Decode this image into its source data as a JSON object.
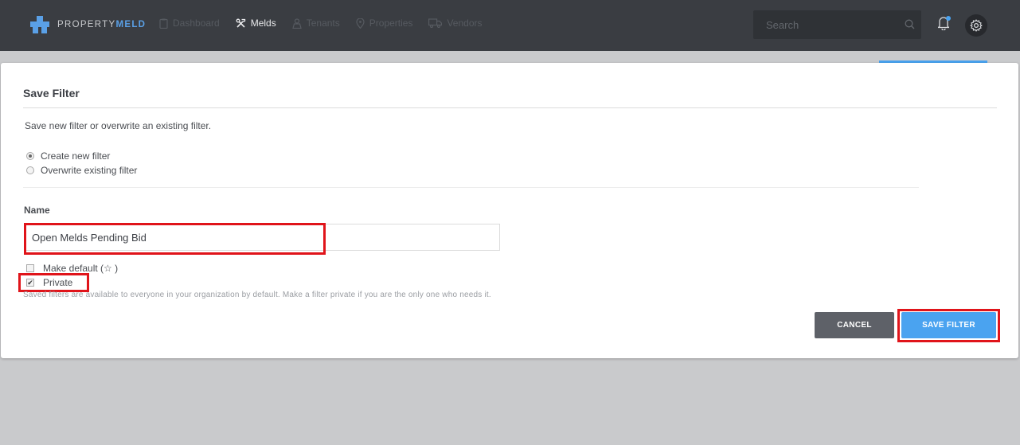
{
  "app": {
    "logo": {
      "prefix": "PROPERTY",
      "suffix": "MELD"
    },
    "nav": [
      {
        "label": "Dashboard",
        "icon": "clipboard-icon",
        "active": false
      },
      {
        "label": "Melds",
        "icon": "tools-icon",
        "active": true
      },
      {
        "label": "Tenants",
        "icon": "person-icon",
        "active": false
      },
      {
        "label": "Properties",
        "icon": "map-pin-icon",
        "active": false
      },
      {
        "label": "Vendors",
        "icon": "truck-icon",
        "active": false
      }
    ],
    "search": {
      "placeholder": "Search",
      "value": ""
    },
    "notifications_icon": "bell-icon",
    "settings_icon": "gear-icon"
  },
  "modal": {
    "title": "Save Filter",
    "description": "Save new filter or overwrite an existing filter.",
    "options": [
      {
        "label": "Create new filter",
        "selected": true
      },
      {
        "label": "Overwrite existing filter",
        "selected": false
      }
    ],
    "name_label": "Name",
    "name_value": "Open Melds Pending Bid",
    "make_default": {
      "label": "Make default (☆ )",
      "checked": false
    },
    "private": {
      "label": "Private",
      "checked": true
    },
    "hint": "Saved filters are available to everyone in your organization by default. Make a filter private if you are the only one who needs it.",
    "cancel_label": "CANCEL",
    "save_label": "SAVE FILTER"
  },
  "colors": {
    "topbar": "#3a3d42",
    "accent": "#4aa3f0",
    "highlight": "#e0141a",
    "cancel_button": "#5e6168"
  }
}
